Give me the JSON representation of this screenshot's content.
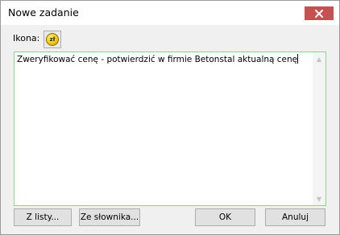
{
  "window": {
    "title": "Nowe zadanie"
  },
  "icon_picker": {
    "label": "Ikona:",
    "glyph": "zł"
  },
  "task_text": "Zweryfikować cenę - potwierdzić w firmie Betonstal aktualną cenę",
  "buttons": {
    "from_list": "Z listy...",
    "from_dictionary": "Ze słownika...",
    "ok": "OK",
    "cancel": "Anuluj"
  },
  "colors": {
    "close_button": "#c75050",
    "text_border": "#8fd18f",
    "coin": "#f1c40f"
  }
}
